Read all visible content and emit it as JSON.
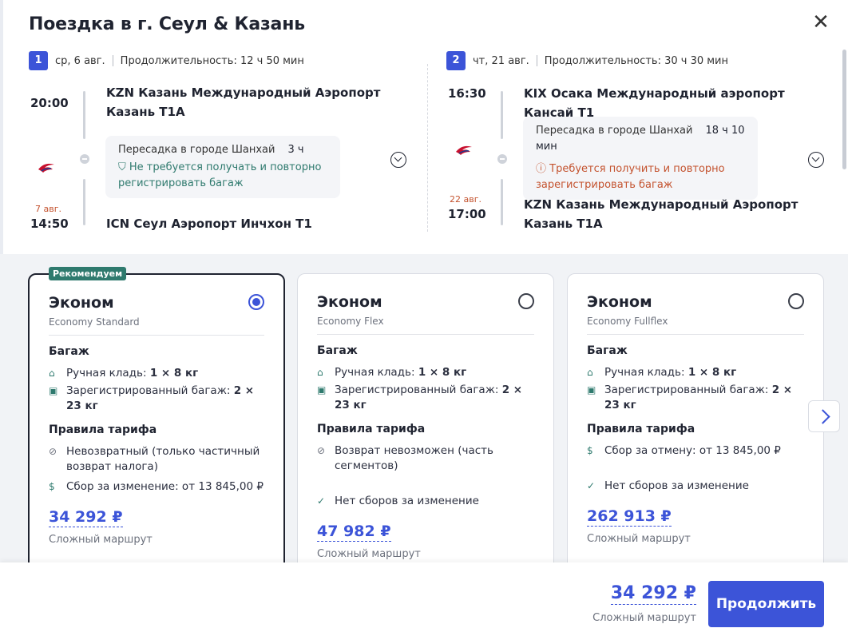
{
  "modal": {
    "title": "Поездка в г. Сеул & Казань"
  },
  "segments": [
    {
      "num": "1",
      "date": "ср, 6 авг.",
      "duration": "Продолжительность: 12 ч 50 мин",
      "dep_time": "20:00",
      "dep_airport_line1": "KZN Казань Международный Аэропорт",
      "dep_airport_line2": "Казань T1A",
      "transfer_city": "Пересадка в городе Шанхай",
      "transfer_duration": "3 ч",
      "baggage_note_line1": "Не требуется получать и повторно",
      "baggage_note_line2": "регистрировать багаж",
      "arr_date": "7 авг.",
      "arr_time": "14:50",
      "arr_airport_line1": "ICN Сеул Аэропорт Инчхон T1"
    },
    {
      "num": "2",
      "date": "чт, 21 авг.",
      "duration": "Продолжительность: 30 ч 30 мин",
      "dep_time": "16:30",
      "dep_airport_line1": "KIX Осака Международный аэропорт Кансай T1",
      "transfer_city": "Пересадка в городе Шанхай",
      "transfer_duration": "18 ч 10 мин",
      "baggage_note_line1": "Требуется получить и повторно",
      "baggage_note_line2": "зарегистрировать багаж",
      "arr_date": "22 авг.",
      "arr_time": "17:00",
      "arr_airport_line1": "KZN Казань Международный Аэропорт",
      "arr_airport_line2": "Казань T1A"
    }
  ],
  "fares": [
    {
      "badge": "Рекомендуем",
      "name": "Эконом",
      "sub": "Economy Standard",
      "baggage_title": "Багаж",
      "carry_label": "Ручная кладь:",
      "carry_value": "1 × 8 кг",
      "checked_label": "Зарегистрированный багаж:",
      "checked_value": "2 × 23 кг",
      "rules_title": "Правила тарифа",
      "rule1": "Невозвратный (только частичный возврат налога)",
      "rule2": "Сбор за изменение: от 13 845,00 ₽",
      "price": "34 292 ₽",
      "price_sub": "Сложный маршрут",
      "selected": true
    },
    {
      "name": "Эконом",
      "sub": "Economy Flex",
      "baggage_title": "Багаж",
      "carry_label": "Ручная кладь:",
      "carry_value": "1 × 8 кг",
      "checked_label": "Зарегистрированный багаж:",
      "checked_value": "2 × 23 кг",
      "rules_title": "Правила тарифа",
      "rule1": "Возврат невозможен (часть сегментов)",
      "rule2": "Нет сборов за изменение",
      "price": "47 982 ₽",
      "price_sub": "Сложный маршрут",
      "selected": false
    },
    {
      "name": "Эконом",
      "sub": "Economy Fullflex",
      "baggage_title": "Багаж",
      "carry_label": "Ручная кладь:",
      "carry_value": "1 × 8 кг",
      "checked_label": "Зарегистрированный багаж:",
      "checked_value": "2 × 23 кг",
      "rules_title": "Правила тарифа",
      "rule1": "Сбор за отмену: от 13 845,00 ₽",
      "rule2": "Нет сборов за изменение",
      "price": "262 913 ₽",
      "price_sub": "Сложный маршрут",
      "selected": false
    }
  ],
  "footer": {
    "price": "34 292 ₽",
    "price_sub": "Сложный маршрут",
    "continue_label": "Продолжить"
  },
  "colors": {
    "accent": "#3c54d8",
    "ok": "#2f7a6e",
    "warn": "#c4532f",
    "badge": "#2f7a6e"
  },
  "icons": {
    "close": "close-icon",
    "airline_logo": "china-eastern-logo",
    "expand": "chevron-down-circle-icon",
    "carry_on": "carry-on-bag-icon",
    "checked_bag": "checked-bag-icon",
    "no_refund": "no-refund-icon",
    "fee": "fee-coin-icon",
    "check": "check-circle-icon",
    "shield": "shield-check-icon",
    "warning": "warning-circle-icon",
    "next": "chevron-right-icon"
  }
}
